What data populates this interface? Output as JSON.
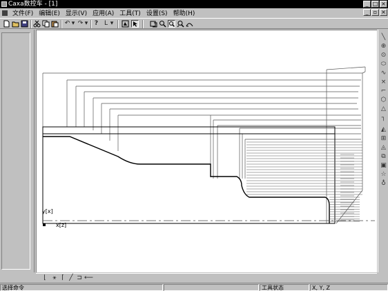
{
  "window": {
    "title": "Caxa数控车 - [1]",
    "controls": [
      "_",
      "□",
      "×"
    ]
  },
  "menubar": {
    "items": [
      "文件(F)",
      "编辑(E)",
      "显示(V)",
      "应用(A)",
      "工具(T)",
      "设置(S)",
      "帮助(H)"
    ],
    "mdi_controls": [
      "_",
      "▫",
      "×"
    ]
  },
  "toolbar": {
    "undo_glyph": "↶",
    "redo_glyph": "↷",
    "help_glyph": "?",
    "layer_glyph": "L"
  },
  "canvas": {
    "y_axis_label": "y[x]",
    "x_axis_label": "x[z]"
  },
  "statusbar": {
    "command_prompt": "选择命令",
    "tool_status": "工具状态",
    "coords": "X, Y, Z"
  },
  "icons": {
    "toolbar": [
      "new-file-icon",
      "open-file-icon",
      "save-icon",
      "cut-icon",
      "copy-icon",
      "paste-icon",
      "undo-icon",
      "redo-icon",
      "help-icon",
      "layer-icon",
      "redraw-icon",
      "pointer-icon",
      "pan-icon",
      "zoom-window-icon",
      "zoom-icon",
      "dynamic-zoom-icon",
      "zoom-previous-icon"
    ],
    "right_toolbar": [
      "line-icon",
      "circle-icon",
      "circle-center-icon",
      "ellipse-icon",
      "spline-icon",
      "point-icon",
      "fillet-icon",
      "polygon-icon",
      "triangle-icon",
      "corner-icon",
      "mirror-icon",
      "array-icon",
      "triangle-small-icon",
      "block-icon",
      "rect-icon",
      "star-icon",
      "bulb-icon"
    ],
    "bottom_toolbar": [
      "lathe-tool-icon",
      "rough-turning-icon",
      "finish-turning-icon",
      "grooving-icon",
      "thread-icon",
      "drill-icon"
    ]
  },
  "colors": {
    "background": "#c0c0c0",
    "titlebar": "#000000",
    "canvas": "#ffffff",
    "toolpath": "#555555",
    "profile": "#000000"
  }
}
